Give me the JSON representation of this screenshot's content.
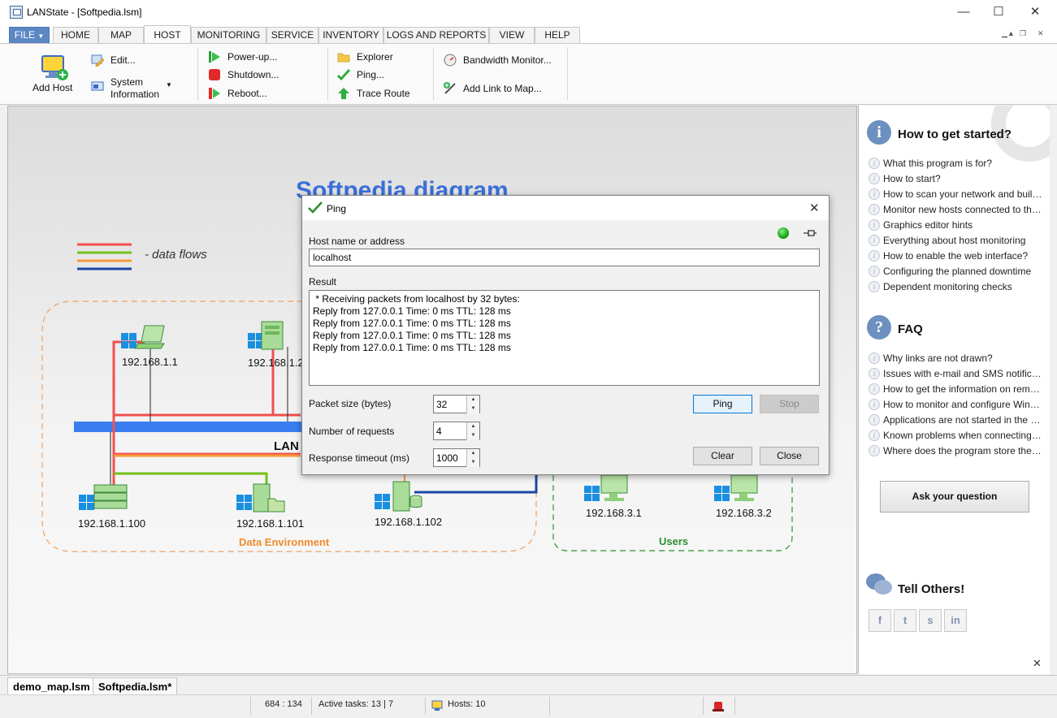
{
  "window": {
    "title": "LANState - [Softpedia.lsm]",
    "minimize": "—",
    "maximize": "☐",
    "close": "✕"
  },
  "menu": {
    "file": "FILE",
    "tabs": [
      "HOME",
      "MAP",
      "HOST",
      "MONITORING",
      "SERVICE",
      "INVENTORY",
      "LOGS AND REPORTS",
      "VIEW",
      "HELP"
    ],
    "active": "HOST"
  },
  "ribbon": {
    "add_host": "Add Host",
    "edit": "Edit...",
    "system_info_1": "System",
    "system_info_2": "Information",
    "power_up": "Power-up...",
    "shutdown": "Shutdown...",
    "reboot": "Reboot...",
    "explorer": "Explorer",
    "ping": "Ping...",
    "trace_route": "Trace Route",
    "bandwidth_monitor": "Bandwidth Monitor...",
    "add_link": "Add Link to Map..."
  },
  "diagram": {
    "title": "Softpedia diagram",
    "legend": "- data flows",
    "lan_label": "LAN",
    "hosts": {
      "h1": "192.168.1.1",
      "h2": "192.168.1.2",
      "h100": "192.168.1.100",
      "h101": "192.168.1.101",
      "h102": "192.168.1.102",
      "u1": "192.168.3.1",
      "u2": "192.168.3.2"
    },
    "zones": {
      "data_env": "Data Environment",
      "users": "Users"
    },
    "colors": {
      "red": "#f0504f",
      "green": "#72c11a",
      "orange": "#f89a3b",
      "blue": "#1a47a5",
      "lan": "#3a7df0"
    }
  },
  "ping_dialog": {
    "title": "Ping",
    "host_label": "Host name or address",
    "host_value": "localhost",
    "result_label": "Result",
    "result_lines": [
      " * Receiving packets from localhost by 32 bytes:",
      "Reply from 127.0.0.1 Time: 0 ms TTL: 128 ms",
      "Reply from 127.0.0.1 Time: 0 ms TTL: 128 ms",
      "Reply from 127.0.0.1 Time: 0 ms TTL: 128 ms",
      "Reply from 127.0.0.1 Time: 0 ms TTL: 128 ms"
    ],
    "packet_size_label": "Packet size (bytes)",
    "packet_size": "32",
    "requests_label": "Number of requests",
    "requests": "4",
    "timeout_label": "Response timeout (ms)",
    "timeout": "1000",
    "ping_btn": "Ping",
    "stop_btn": "Stop",
    "clear_btn": "Clear",
    "close_btn": "Close"
  },
  "side": {
    "how_title": "How to get started?",
    "how_links": [
      "What this program is for?",
      "How to start?",
      "How to scan your network and build a map?",
      "Monitor new hosts connected to the network",
      "Graphics editor hints",
      "Everything about host monitoring",
      "How to enable the web interface?",
      "Configuring the planned downtime",
      "Dependent monitoring checks"
    ],
    "faq_title": "FAQ",
    "faq_links": [
      "Why links are not drawn?",
      "Issues with e-mail and SMS notifications",
      "How to get the information on remote hosts?",
      "How to monitor and configure Windows services?",
      "Applications are not started in the remote session",
      "Known problems when connecting to hosts",
      "Where does the program store the settings?"
    ],
    "ask_button": "Ask your question",
    "tell_title": "Tell Others!",
    "social": [
      "f",
      "t",
      "s",
      "in"
    ]
  },
  "doc_tabs": [
    "demo_map.lsm",
    "Softpedia.lsm*"
  ],
  "status": {
    "coords": "684 : 134",
    "tasks": "Active tasks: 13 | 7",
    "hosts": "Hosts: 10"
  }
}
